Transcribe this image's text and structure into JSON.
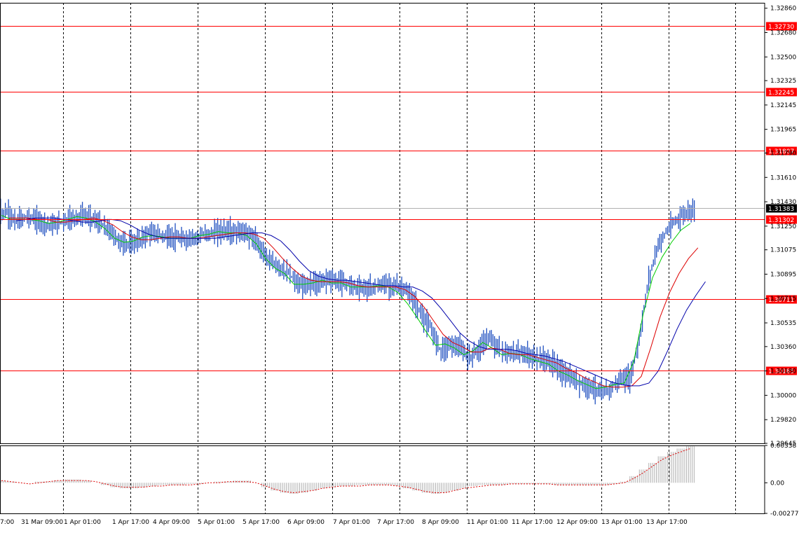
{
  "chart_data": [
    {
      "type": "candlestick",
      "title": "",
      "price_axis": {
        "ylim": [
          1.29645,
          1.2904
        ],
        "ticks": [
          "1.32860",
          "1.32680",
          "1.32500",
          "1.32325",
          "1.32145",
          "1.31965",
          "1.31790",
          "1.31610",
          "1.31430",
          "1.31250",
          "1.31075",
          "1.30895",
          "1.30715",
          "1.30535",
          "1.30360",
          "1.30180",
          "1.30000",
          "1.29820",
          "1.29645"
        ]
      },
      "time_axis": {
        "labels": [
          "7:00",
          "31 Mar 09:00",
          "1 Apr 01:00",
          "1 Apr 17:00",
          "4 Apr 09:00",
          "5 Apr 01:00",
          "5 Apr 17:00",
          "6 Apr 09:00",
          "7 Apr 01:00",
          "7 Apr 17:00",
          "8 Apr 09:00",
          "11 Apr 01:00",
          "11 Apr 17:00",
          "12 Apr 09:00",
          "13 Apr 01:00",
          "13 Apr 17:00"
        ]
      },
      "levels": [
        {
          "value": 1.3273,
          "label": "1.32730"
        },
        {
          "value": 1.32245,
          "label": "1.32245"
        },
        {
          "value": 1.31807,
          "label": "1.31807"
        },
        {
          "value": 1.31302,
          "label": "1.31302"
        },
        {
          "value": 1.30711,
          "label": "1.30711"
        },
        {
          "value": 1.30185,
          "label": "1.30185"
        }
      ],
      "current_price": {
        "value": 1.31383,
        "label": "1.31383"
      },
      "colors": {
        "bars": "#2050c0",
        "levels": "#ff0000",
        "ma_fast": "#00cc00",
        "ma_mid": "#dd0000",
        "ma_slow": "#0000aa"
      },
      "series": [
        {
          "name": "price-close",
          "values": [
            1.3135,
            1.3128,
            1.3132,
            1.313,
            1.3127,
            1.3126,
            1.3129,
            1.3131,
            1.3133,
            1.3131,
            1.3126,
            1.3121,
            1.3113,
            1.3112,
            1.3114,
            1.312,
            1.3119,
            1.3117,
            1.3116,
            1.3115,
            1.3117,
            1.3119,
            1.312,
            1.3122,
            1.312,
            1.3121,
            1.3117,
            1.3108,
            1.3098,
            1.3094,
            1.3089,
            1.3081,
            1.3082,
            1.3083,
            1.3087,
            1.3084,
            1.3083,
            1.308,
            1.3079,
            1.308,
            1.3082,
            1.3081,
            1.3079,
            1.3071,
            1.3059,
            1.3048,
            1.3033,
            1.3038,
            1.3035,
            1.3028,
            1.3034,
            1.3043,
            1.3035,
            1.303,
            1.3032,
            1.303,
            1.3028,
            1.3026,
            1.3023,
            1.3016,
            1.3012,
            1.3008,
            1.3006,
            1.3002,
            1.3005,
            1.3012,
            1.3012,
            1.304,
            1.3086,
            1.3111,
            1.3122,
            1.313,
            1.3135,
            1.3138
          ]
        },
        {
          "name": "ma-fast",
          "values": [
            1.3133,
            1.313,
            1.313,
            1.313,
            1.3129,
            1.3127,
            1.3128,
            1.313,
            1.3132,
            1.3131,
            1.3128,
            1.3123,
            1.3116,
            1.3113,
            1.3114,
            1.3117,
            1.3118,
            1.3117,
            1.3116,
            1.3116,
            1.3116,
            1.3118,
            1.3119,
            1.3121,
            1.312,
            1.312,
            1.3118,
            1.3112,
            1.3101,
            1.3094,
            1.309,
            1.3082,
            1.3082,
            1.3083,
            1.3085,
            1.3083,
            1.3083,
            1.308,
            1.308,
            1.308,
            1.3081,
            1.308,
            1.3076,
            1.3068,
            1.3058,
            1.3047,
            1.3037,
            1.3038,
            1.3035,
            1.303,
            1.3033,
            1.3039,
            1.3035,
            1.303,
            1.3031,
            1.303,
            1.3027,
            1.3025,
            1.3023,
            1.3018,
            1.3015,
            1.3011,
            1.3008,
            1.3005,
            1.3006,
            1.3008,
            1.3009,
            1.3025,
            1.306,
            1.3087,
            1.3102,
            1.3113,
            1.3122,
            1.3127
          ]
        },
        {
          "name": "ma-mid",
          "values": [
            1.3131,
            1.3131,
            1.3131,
            1.313,
            1.313,
            1.3128,
            1.3128,
            1.3129,
            1.313,
            1.3131,
            1.3129,
            1.3126,
            1.3121,
            1.3117,
            1.3115,
            1.3115,
            1.3116,
            1.3117,
            1.3117,
            1.3116,
            1.3116,
            1.3117,
            1.3118,
            1.3119,
            1.312,
            1.312,
            1.3119,
            1.3116,
            1.3109,
            1.3101,
            1.3094,
            1.3088,
            1.3085,
            1.3084,
            1.3084,
            1.3084,
            1.3083,
            1.3081,
            1.308,
            1.308,
            1.308,
            1.308,
            1.3078,
            1.3073,
            1.3065,
            1.3055,
            1.3045,
            1.3039,
            1.3036,
            1.3032,
            1.3032,
            1.3035,
            1.3034,
            1.3031,
            1.303,
            1.303,
            1.3028,
            1.3026,
            1.3024,
            1.302,
            1.3017,
            1.3013,
            1.301,
            1.3007,
            1.3006,
            1.3006,
            1.3007,
            1.3014,
            1.3035,
            1.3058,
            1.3076,
            1.309,
            1.3101,
            1.3109
          ]
        },
        {
          "name": "ma-slow",
          "values": [
            1.3129,
            1.313,
            1.3131,
            1.3131,
            1.3131,
            1.313,
            1.3129,
            1.3128,
            1.3128,
            1.3129,
            1.313,
            1.3129,
            1.3126,
            1.3122,
            1.3119,
            1.3117,
            1.3116,
            1.3116,
            1.3116,
            1.3116,
            1.3116,
            1.3116,
            1.3117,
            1.3118,
            1.3119,
            1.312,
            1.312,
            1.3118,
            1.3114,
            1.3107,
            1.3099,
            1.3092,
            1.3088,
            1.3086,
            1.3085,
            1.3085,
            1.3084,
            1.3083,
            1.3082,
            1.3081,
            1.3081,
            1.308,
            1.308,
            1.3077,
            1.3072,
            1.3064,
            1.3055,
            1.3046,
            1.304,
            1.3036,
            1.3034,
            1.3034,
            1.3034,
            1.3033,
            1.3031,
            1.303,
            1.3029,
            1.3027,
            1.3025,
            1.3022,
            1.3019,
            1.3016,
            1.3013,
            1.301,
            1.3008,
            1.3007,
            1.3007,
            1.3009,
            1.3018,
            1.3033,
            1.3049,
            1.3063,
            1.3074,
            1.3084
          ]
        }
      ]
    },
    {
      "type": "bar",
      "title": "",
      "ylim": [
        -0.002773,
        0.00338
      ],
      "ticks": [
        "0.00338",
        "0.00",
        "-0.002773"
      ],
      "colors": {
        "histogram": "#b0b0b0",
        "signal": "#dd0000"
      },
      "series": [
        {
          "name": "oscillator",
          "values": [
            0.0002,
            0.0001,
            0.0,
            0.0,
            0.0001,
            0.0001,
            0.0002,
            0.0003,
            0.0003,
            0.0002,
            0.0,
            -0.0002,
            -0.0004,
            -0.0005,
            -0.0005,
            -0.0004,
            -0.0003,
            -0.0002,
            -0.0002,
            -0.0002,
            -0.0001,
            -0.0001,
            0.0,
            0.0001,
            0.0001,
            0.0002,
            0.0002,
            0.0,
            -0.0004,
            -0.0007,
            -0.0009,
            -0.001,
            -0.0009,
            -0.0007,
            -0.0005,
            -0.0004,
            -0.0003,
            -0.0003,
            -0.0002,
            -0.0002,
            -0.0002,
            -0.0002,
            -0.0003,
            -0.0005,
            -0.0007,
            -0.0009,
            -0.001,
            -0.0009,
            -0.0007,
            -0.0005,
            -0.0003,
            -0.0002,
            -0.0002,
            -0.0002,
            -0.0001,
            -0.0001,
            -0.0001,
            -0.0001,
            -0.0001,
            -0.0002,
            -0.0002,
            -0.0002,
            -0.0002,
            -0.0002,
            -0.0002,
            -0.0001,
            0.0001,
            0.0006,
            0.0012,
            0.0018,
            0.0024,
            0.0028,
            0.0031,
            0.0033
          ]
        },
        {
          "name": "signal",
          "values": [
            0.0002,
            0.0001,
            0.0,
            -0.0001,
            0.0,
            0.0001,
            0.0002,
            0.0002,
            0.0002,
            0.0002,
            0.0001,
            -0.0001,
            -0.0003,
            -0.0004,
            -0.0004,
            -0.0004,
            -0.0003,
            -0.0003,
            -0.0002,
            -0.0002,
            -0.0002,
            -0.0001,
            0.0,
            0.0,
            0.0001,
            0.0001,
            0.0001,
            0.0,
            -0.0003,
            -0.0006,
            -0.0008,
            -0.0009,
            -0.0008,
            -0.0007,
            -0.0005,
            -0.0004,
            -0.0003,
            -0.0003,
            -0.0003,
            -0.0002,
            -0.0002,
            -0.0002,
            -0.0003,
            -0.0004,
            -0.0006,
            -0.0008,
            -0.0009,
            -0.0009,
            -0.0007,
            -0.0005,
            -0.0004,
            -0.0003,
            -0.0002,
            -0.0002,
            -0.0001,
            -0.0001,
            -0.0001,
            -0.0001,
            -0.0001,
            -0.0002,
            -0.0002,
            -0.0002,
            -0.0002,
            -0.0002,
            -0.0002,
            -0.0001,
            0.0,
            0.0004,
            0.0009,
            0.0015,
            0.0021,
            0.0025,
            0.0028,
            0.0031
          ]
        }
      ]
    }
  ]
}
